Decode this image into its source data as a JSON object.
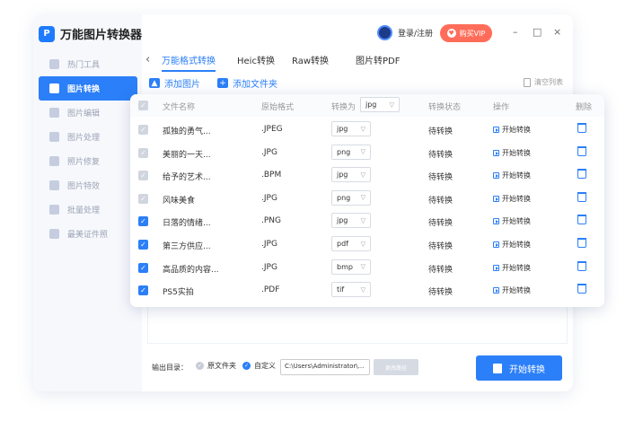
{
  "app": {
    "title": "万能图片转换器",
    "logo_text": "P"
  },
  "sidebar": {
    "items": [
      {
        "label": "热门工具",
        "active": false
      },
      {
        "label": "图片转换",
        "active": true
      },
      {
        "label": "图片编辑",
        "active": false
      },
      {
        "label": "图片处理",
        "active": false
      },
      {
        "label": "照片修复",
        "active": false
      },
      {
        "label": "图片特效",
        "active": false
      },
      {
        "label": "批量处理",
        "active": false
      },
      {
        "label": "最美证件照",
        "active": false
      }
    ]
  },
  "header": {
    "login_label": "登录/注册",
    "vip_label": "购买VIP",
    "minimize": "–",
    "maximize": "□",
    "close": "×"
  },
  "tabs": [
    {
      "label": "万能格式转换",
      "active": true
    },
    {
      "label": "Heic转换",
      "active": false
    },
    {
      "label": "Raw转换",
      "active": false
    },
    {
      "label": "图片转PDF",
      "active": false
    }
  ],
  "toolbar": {
    "add_image": "添加图片",
    "add_folder": "添加文件夹",
    "clear_list": "清空列表"
  },
  "table": {
    "headers": {
      "name": "文件名称",
      "orig_format": "原始格式",
      "convert_to": "转换为",
      "convert_to_value": "jpg",
      "status": "转换状态",
      "action": "操作",
      "delete": "删除"
    },
    "rows": [
      {
        "name": "孤独的勇气...",
        "format": ".JPEG",
        "target": "jpg",
        "status": "待转换",
        "action": "开始转换",
        "checked": false
      },
      {
        "name": "美丽的一天...",
        "format": ".JPG",
        "target": "png",
        "status": "待转换",
        "action": "开始转换",
        "checked": false
      },
      {
        "name": "给予的艺术...",
        "format": ".BPM",
        "target": "jpg",
        "status": "待转换",
        "action": "开始转换",
        "checked": false
      },
      {
        "name": "风味美食",
        "format": ".JPG",
        "target": "png",
        "status": "待转换",
        "action": "开始转换",
        "checked": false
      },
      {
        "name": "日落的情绪...",
        "format": ".PNG",
        "target": "jpg",
        "status": "待转换",
        "action": "开始转换",
        "checked": true
      },
      {
        "name": "第三方供应...",
        "format": ".JPG",
        "target": "pdf",
        "status": "待转换",
        "action": "开始转换",
        "checked": true
      },
      {
        "name": "高品质的内容...",
        "format": ".JPG",
        "target": "bmp",
        "status": "待转换",
        "action": "开始转换",
        "checked": true
      },
      {
        "name": "PS5实拍",
        "format": ".PDF",
        "target": "tif",
        "status": "待转换",
        "action": "开始转换",
        "checked": true
      }
    ]
  },
  "output": {
    "label": "输出目录：",
    "option_original": "原文件夹",
    "option_custom": "自定义",
    "path_value": "C:\\Users\\Administrator\\...",
    "change_path": "更改路径",
    "start_button": "开始转换"
  },
  "colors": {
    "accent": "#2b7ff8",
    "vip": "#ff6d5a",
    "checkbox_off": "#d0d5de"
  }
}
